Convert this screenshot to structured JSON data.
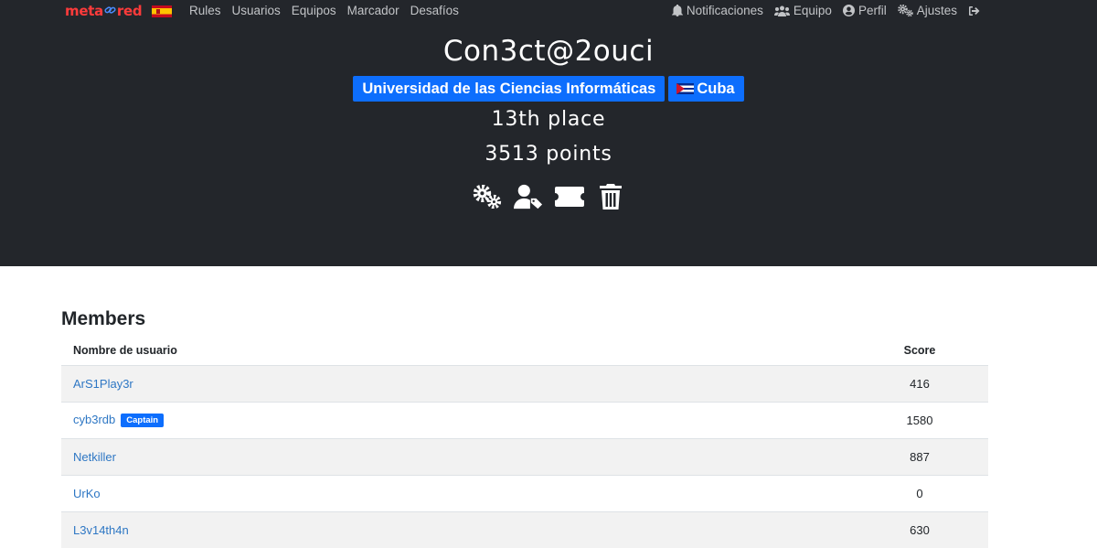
{
  "nav": {
    "brand": {
      "part1": "meta",
      "part2": "red"
    },
    "language_flag": "spain-flag-icon",
    "links": [
      "Rules",
      "Usuarios",
      "Equipos",
      "Marcador",
      "Desafíos"
    ],
    "right": {
      "notifications": "Notificaciones",
      "team": "Equipo",
      "profile": "Perfil",
      "settings": "Ajustes"
    }
  },
  "team": {
    "name": "Con3ct@2ouci",
    "affiliation": "Universidad de las Ciencias Informáticas",
    "country": "Cuba",
    "place": "13th place",
    "points": "3513 points"
  },
  "actions": [
    "settings-icon",
    "user-tag-icon",
    "ticket-icon",
    "trash-icon"
  ],
  "members": {
    "title": "Members",
    "columns": {
      "name": "Nombre de usuario",
      "score": "Score"
    },
    "captain_label": "Captain",
    "rows": [
      {
        "name": "ArS1Play3r",
        "score": "416"
      },
      {
        "name": "cyb3rdb",
        "score": "1580",
        "captain": true
      },
      {
        "name": "Netkiller",
        "score": "887"
      },
      {
        "name": "UrKo",
        "score": "0"
      },
      {
        "name": "L3v14th4n",
        "score": "630"
      }
    ]
  },
  "colors": {
    "header_bg": "#23262b",
    "accent": "#0d6efd",
    "link": "#2e77c4",
    "brand": "#ff3b3b"
  }
}
